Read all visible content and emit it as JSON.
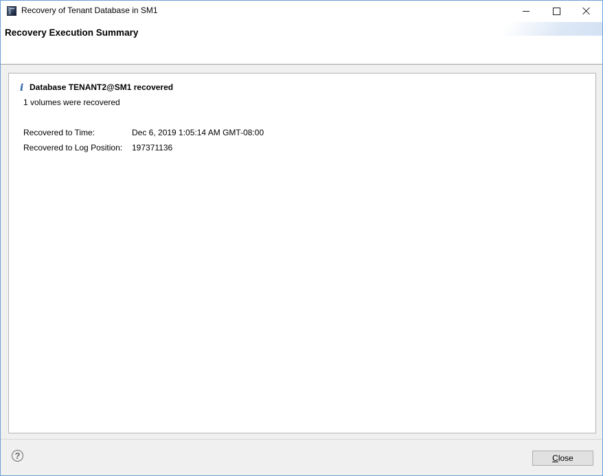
{
  "window": {
    "title": "Recovery of Tenant Database in SM1"
  },
  "header": {
    "title": "Recovery Execution Summary"
  },
  "summary": {
    "icon": "info-icon",
    "title": "Database TENANT2@SM1 recovered",
    "subtitle": "1 volumes were recovered",
    "details": [
      {
        "label": "Recovered to Time:",
        "value": "Dec 6, 2019 1:05:14 AM GMT-08:00"
      },
      {
        "label": "Recovered to Log Position:",
        "value": "197371136"
      }
    ]
  },
  "footer": {
    "help_icon": "question-mark-icon",
    "close_mnemonic": "C",
    "close_rest": "lose"
  },
  "colors": {
    "info_accent": "#2a62a8",
    "window_border": "#6b9fd8"
  }
}
